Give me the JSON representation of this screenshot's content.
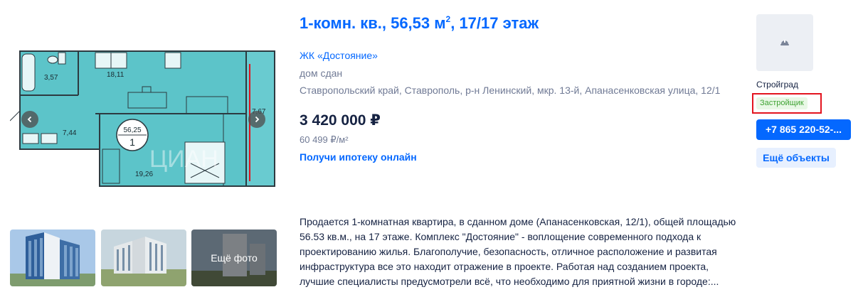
{
  "listing": {
    "title_main": "1-комн. кв., 56,53 м",
    "title_sup": "2",
    "title_tail": ", 17/17 этаж",
    "complex_link": "ЖК «Достояние»",
    "status": "дом сдан",
    "address": "Ставропольский край, Ставрополь, р-н Ленинский, мкр. 13-й, Апанасенковская улица, 12/1",
    "price": "3 420 000 ₽",
    "price_per_m2": "60 499 ₽/м²",
    "mortgage_link": "Получи ипотеку онлайн",
    "description": "Продается 1-комнатная квартира, в сданном доме (Апанасенковская, 12/1), общей площадью 56.53 кв.м., на 17 этаже. Комплекс \"Достояние\" - воплощение современного подхода к проектированию жилья. Благополучие, безопасность, отличное расположение и развитая инфраструктура все это находит отражение в проекте. Работая над созданием проекта, лучшие специалисты предусмотрели всё, что необходимо для приятной жизни в городе:..."
  },
  "floorplan": {
    "room_bath": "3,57",
    "room_kitchen": "18,11",
    "room_hall": "7,44",
    "room_bedroom": "19,26",
    "room_balcony": "7,67",
    "total_area": "56,25",
    "rooms_count": "1",
    "watermark": "ЦИАН"
  },
  "gallery": {
    "more_photos_label": "Ещё фото",
    "icons": {
      "prev": "chevron-left-icon",
      "next": "chevron-right-icon"
    }
  },
  "developer": {
    "name": "Стройград",
    "badge": "Застройщик",
    "phone_button": "+7 865 220-52-...",
    "more_objects_button": "Ещё объекты",
    "logo_icon": "helmet-icon"
  },
  "colors": {
    "link_blue": "#0468ff",
    "text_dark": "#152242",
    "text_gray": "#707a95",
    "badge_green": "#3fa333",
    "badge_bg": "#e9f8e6",
    "highlight_red": "#e3141f",
    "plan_fill": "#5cc4c9"
  }
}
